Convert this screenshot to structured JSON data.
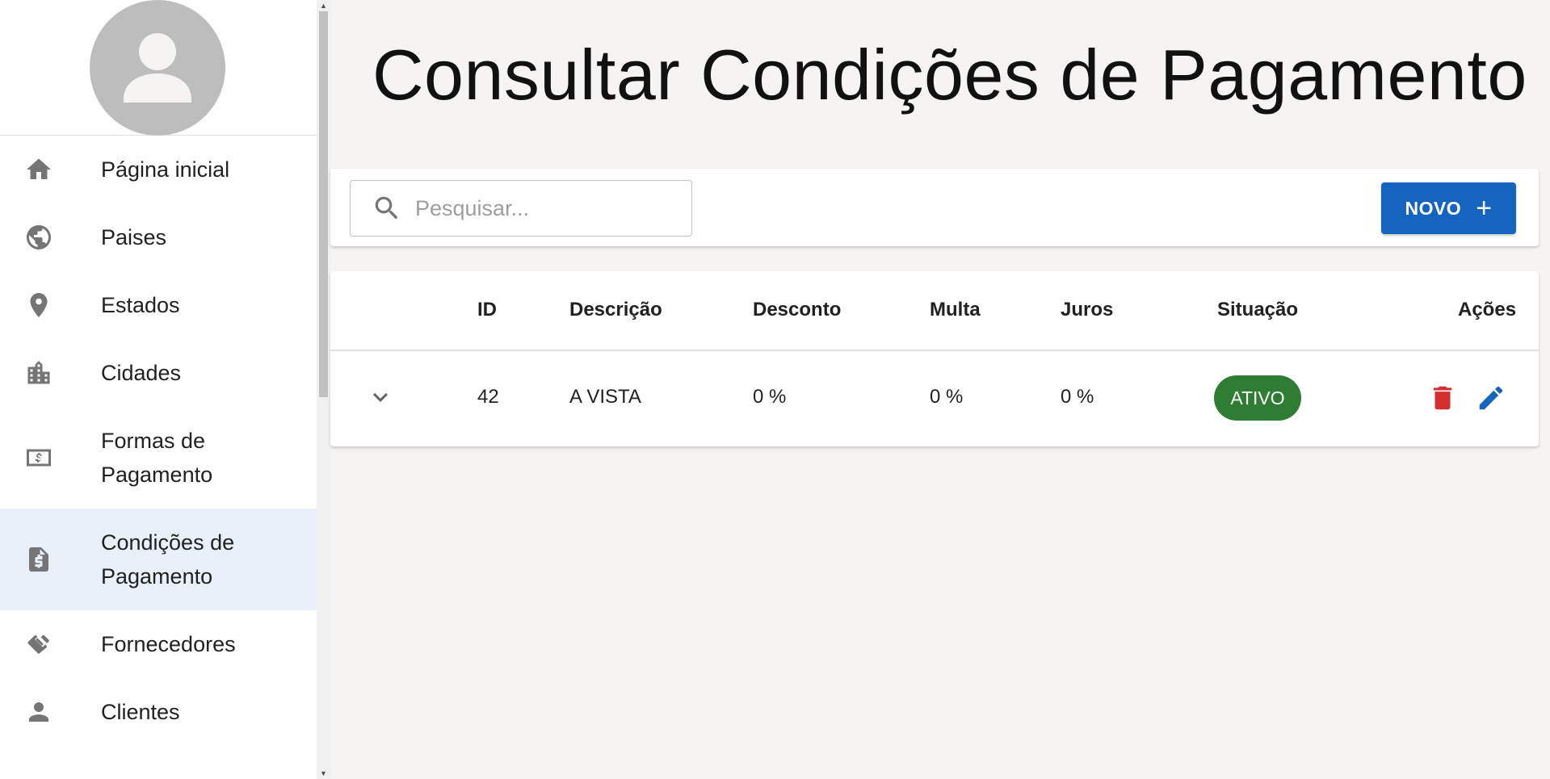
{
  "sidebar": {
    "items": [
      {
        "label": "Página inicial",
        "icon": "home-icon"
      },
      {
        "label": "Paises",
        "icon": "globe-icon"
      },
      {
        "label": "Estados",
        "icon": "location-pin-icon"
      },
      {
        "label": "Cidades",
        "icon": "city-icon"
      },
      {
        "label": "Formas de Pagamento",
        "icon": "money-icon"
      },
      {
        "label": "Condições de Pagamento",
        "icon": "receipt-dollar-icon",
        "active": true
      },
      {
        "label": "Fornecedores",
        "icon": "handshake-icon"
      },
      {
        "label": "Clientes",
        "icon": "person-icon"
      }
    ]
  },
  "page": {
    "title": "Consultar Condições de Pagamento"
  },
  "toolbar": {
    "search_placeholder": "Pesquisar...",
    "new_label": "NOVO",
    "new_icon": "plus-icon"
  },
  "table": {
    "headers": {
      "id": "ID",
      "description": "Descrição",
      "discount": "Desconto",
      "fine": "Multa",
      "interest": "Juros",
      "status": "Situação",
      "actions": "Ações"
    },
    "rows": [
      {
        "id": "42",
        "description": "A VISTA",
        "discount": "0 %",
        "fine": "0 %",
        "interest": "0 %",
        "status": "ATIVO"
      }
    ]
  },
  "colors": {
    "primary": "#1565c0",
    "active_status": "#2e7d32",
    "delete": "#d32f2f",
    "edit": "#1565c0",
    "sidebar_active": "#e9f0fa"
  }
}
